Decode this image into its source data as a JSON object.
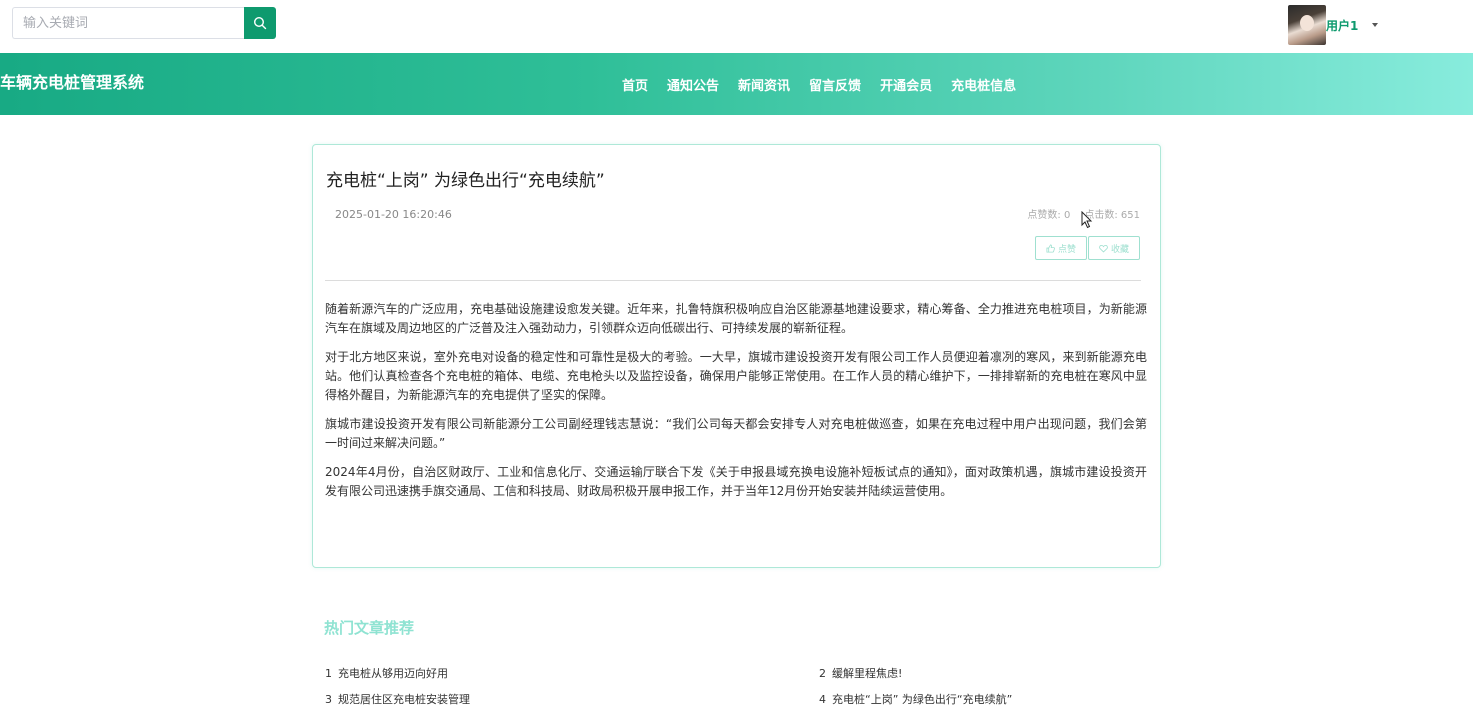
{
  "search": {
    "placeholder": "输入关键词"
  },
  "user": {
    "name": "用户1"
  },
  "site": {
    "title": "车辆充电桩管理系统"
  },
  "nav": {
    "items": [
      "首页",
      "通知公告",
      "新闻资讯",
      "留言反馈",
      "开通会员",
      "充电桩信息"
    ]
  },
  "article": {
    "title": "充电桩“上岗” 为绿色出行“充电续航”",
    "date": "2025-01-20 16:20:46",
    "likes_label": "点赞数:",
    "likes": "0",
    "clicks_label": "点击数:",
    "clicks": "651",
    "like_button": "点赞",
    "favorite_button": "收藏",
    "paragraphs": [
      "随着新源汽车的广泛应用，充电基础设施建设愈发关键。近年来，扎鲁特旗积极响应自治区能源基地建设要求，精心筹备、全力推进充电桩项目，为新能源汽车在旗域及周边地区的广泛普及注入强劲动力，引领群众迈向低碳出行、可持续发展的崭新征程。",
      "对于北方地区来说，室外充电对设备的稳定性和可靠性是极大的考验。一大早，旗城市建设投资开发有限公司工作人员便迎着凛冽的寒风，来到新能源充电站。他们认真检查各个充电桩的箱体、电缆、充电枪头以及监控设备，确保用户能够正常使用。在工作人员的精心维护下，一排排崭新的充电桩在寒风中显得格外醒目，为新能源汽车的充电提供了坚实的保障。",
      "旗城市建设投资开发有限公司新能源分工公司副经理钱志慧说：“我们公司每天都会安排专人对充电桩做巡查，如果在充电过程中用户出现问题，我们会第一时间过来解决问题。”",
      "2024年4月份，自治区财政厅、工业和信息化厅、交通运输厅联合下发《关于申报县域充换电设施补短板试点的通知》，面对政策机遇，旗城市建设投资开发有限公司迅速携手旗交通局、工信和科技局、财政局积极开展申报工作，并于当年12月份开始安装并陆续运营使用。"
    ]
  },
  "hot": {
    "title": "热门文章推荐",
    "items": [
      {
        "num": "1",
        "title": "充电桩从够用迈向好用"
      },
      {
        "num": "2",
        "title": "缓解里程焦虑!"
      },
      {
        "num": "3",
        "title": "规范居住区充电桩安装管理"
      },
      {
        "num": "4",
        "title": "充电桩“上岗” 为绿色出行“充电续航”"
      }
    ]
  },
  "colors": {
    "brand": "#0e9a6e",
    "header_start": "#18aa84",
    "header_end": "#88ecdd",
    "accent_light": "#8fe3d2"
  },
  "icons": [
    "search-icon",
    "caret-down-icon",
    "thumb-up-icon",
    "heart-icon",
    "mouse-cursor-icon"
  ]
}
